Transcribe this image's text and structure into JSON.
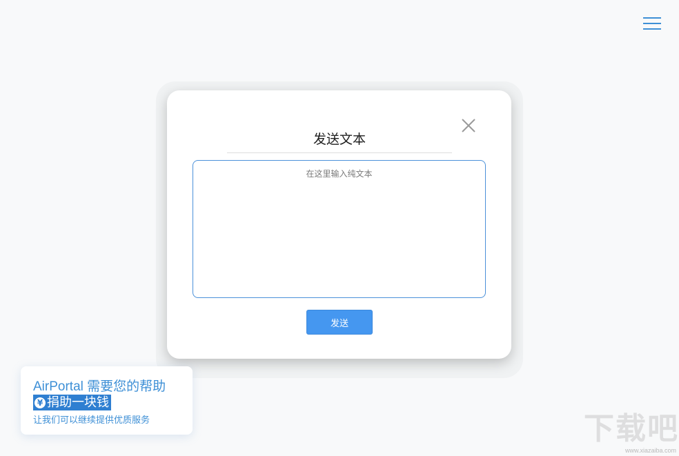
{
  "header": {
    "menu_icon": "hamburger-menu-icon"
  },
  "modal": {
    "title": "发送文本",
    "close_icon": "close-icon",
    "textarea": {
      "value": "",
      "placeholder": "在这里输入纯文本"
    },
    "send_label": "发送"
  },
  "donate": {
    "line1": "AirPortal 需要您的帮助",
    "icon": "yen-icon",
    "yen_symbol": "¥",
    "line2": "捐助一块钱",
    "line3": "让我们可以继续提供优质服务"
  },
  "watermark": {
    "logo": "下载吧",
    "url": "www.xiazaiba.com"
  },
  "colors": {
    "accent": "#3d8fd6",
    "button": "#4597f0",
    "background": "#f8f9fa"
  }
}
